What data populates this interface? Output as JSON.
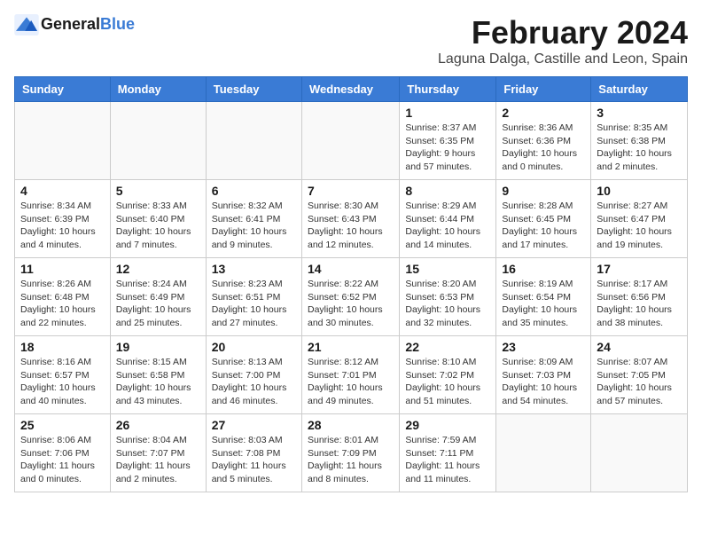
{
  "logo": {
    "general": "General",
    "blue": "Blue"
  },
  "title": "February 2024",
  "location": "Laguna Dalga, Castille and Leon, Spain",
  "days_of_week": [
    "Sunday",
    "Monday",
    "Tuesday",
    "Wednesday",
    "Thursday",
    "Friday",
    "Saturday"
  ],
  "weeks": [
    [
      {
        "day": "",
        "info": ""
      },
      {
        "day": "",
        "info": ""
      },
      {
        "day": "",
        "info": ""
      },
      {
        "day": "",
        "info": ""
      },
      {
        "day": "1",
        "info": "Sunrise: 8:37 AM\nSunset: 6:35 PM\nDaylight: 9 hours and 57 minutes."
      },
      {
        "day": "2",
        "info": "Sunrise: 8:36 AM\nSunset: 6:36 PM\nDaylight: 10 hours and 0 minutes."
      },
      {
        "day": "3",
        "info": "Sunrise: 8:35 AM\nSunset: 6:38 PM\nDaylight: 10 hours and 2 minutes."
      }
    ],
    [
      {
        "day": "4",
        "info": "Sunrise: 8:34 AM\nSunset: 6:39 PM\nDaylight: 10 hours and 4 minutes."
      },
      {
        "day": "5",
        "info": "Sunrise: 8:33 AM\nSunset: 6:40 PM\nDaylight: 10 hours and 7 minutes."
      },
      {
        "day": "6",
        "info": "Sunrise: 8:32 AM\nSunset: 6:41 PM\nDaylight: 10 hours and 9 minutes."
      },
      {
        "day": "7",
        "info": "Sunrise: 8:30 AM\nSunset: 6:43 PM\nDaylight: 10 hours and 12 minutes."
      },
      {
        "day": "8",
        "info": "Sunrise: 8:29 AM\nSunset: 6:44 PM\nDaylight: 10 hours and 14 minutes."
      },
      {
        "day": "9",
        "info": "Sunrise: 8:28 AM\nSunset: 6:45 PM\nDaylight: 10 hours and 17 minutes."
      },
      {
        "day": "10",
        "info": "Sunrise: 8:27 AM\nSunset: 6:47 PM\nDaylight: 10 hours and 19 minutes."
      }
    ],
    [
      {
        "day": "11",
        "info": "Sunrise: 8:26 AM\nSunset: 6:48 PM\nDaylight: 10 hours and 22 minutes."
      },
      {
        "day": "12",
        "info": "Sunrise: 8:24 AM\nSunset: 6:49 PM\nDaylight: 10 hours and 25 minutes."
      },
      {
        "day": "13",
        "info": "Sunrise: 8:23 AM\nSunset: 6:51 PM\nDaylight: 10 hours and 27 minutes."
      },
      {
        "day": "14",
        "info": "Sunrise: 8:22 AM\nSunset: 6:52 PM\nDaylight: 10 hours and 30 minutes."
      },
      {
        "day": "15",
        "info": "Sunrise: 8:20 AM\nSunset: 6:53 PM\nDaylight: 10 hours and 32 minutes."
      },
      {
        "day": "16",
        "info": "Sunrise: 8:19 AM\nSunset: 6:54 PM\nDaylight: 10 hours and 35 minutes."
      },
      {
        "day": "17",
        "info": "Sunrise: 8:17 AM\nSunset: 6:56 PM\nDaylight: 10 hours and 38 minutes."
      }
    ],
    [
      {
        "day": "18",
        "info": "Sunrise: 8:16 AM\nSunset: 6:57 PM\nDaylight: 10 hours and 40 minutes."
      },
      {
        "day": "19",
        "info": "Sunrise: 8:15 AM\nSunset: 6:58 PM\nDaylight: 10 hours and 43 minutes."
      },
      {
        "day": "20",
        "info": "Sunrise: 8:13 AM\nSunset: 7:00 PM\nDaylight: 10 hours and 46 minutes."
      },
      {
        "day": "21",
        "info": "Sunrise: 8:12 AM\nSunset: 7:01 PM\nDaylight: 10 hours and 49 minutes."
      },
      {
        "day": "22",
        "info": "Sunrise: 8:10 AM\nSunset: 7:02 PM\nDaylight: 10 hours and 51 minutes."
      },
      {
        "day": "23",
        "info": "Sunrise: 8:09 AM\nSunset: 7:03 PM\nDaylight: 10 hours and 54 minutes."
      },
      {
        "day": "24",
        "info": "Sunrise: 8:07 AM\nSunset: 7:05 PM\nDaylight: 10 hours and 57 minutes."
      }
    ],
    [
      {
        "day": "25",
        "info": "Sunrise: 8:06 AM\nSunset: 7:06 PM\nDaylight: 11 hours and 0 minutes."
      },
      {
        "day": "26",
        "info": "Sunrise: 8:04 AM\nSunset: 7:07 PM\nDaylight: 11 hours and 2 minutes."
      },
      {
        "day": "27",
        "info": "Sunrise: 8:03 AM\nSunset: 7:08 PM\nDaylight: 11 hours and 5 minutes."
      },
      {
        "day": "28",
        "info": "Sunrise: 8:01 AM\nSunset: 7:09 PM\nDaylight: 11 hours and 8 minutes."
      },
      {
        "day": "29",
        "info": "Sunrise: 7:59 AM\nSunset: 7:11 PM\nDaylight: 11 hours and 11 minutes."
      },
      {
        "day": "",
        "info": ""
      },
      {
        "day": "",
        "info": ""
      }
    ]
  ]
}
